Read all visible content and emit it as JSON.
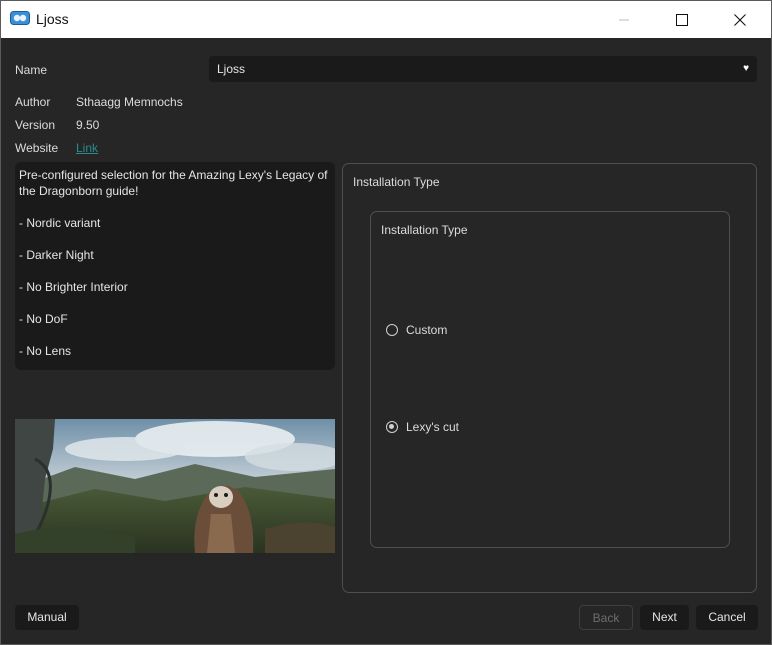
{
  "window": {
    "title": "Ljoss"
  },
  "header": {
    "name_label": "Name",
    "name_value": "Ljoss",
    "author_label": "Author",
    "author_value": "Sthaagg Memnochs",
    "version_label": "Version",
    "version_value": "9.50",
    "website_label": "Website",
    "website_link": "Link"
  },
  "description": {
    "lines": [
      "Pre-configured selection for the Amazing Lexy's Legacy of the Dragonborn guide!",
      "- Nordic variant",
      "- Darker Night",
      "- No Brighter Interior",
      "- No DoF",
      "- No Lens"
    ]
  },
  "installation": {
    "group_title": "Installation Type",
    "inner_title": "Installation Type",
    "options": [
      {
        "label": "Custom",
        "checked": false
      },
      {
        "label": "Lexy's cut",
        "checked": true
      }
    ]
  },
  "buttons": {
    "manual": "Manual",
    "back": "Back",
    "next": "Next",
    "cancel": "Cancel"
  },
  "colors": {
    "background": "#262626",
    "field": "#1a1a1a",
    "link": "#2a8c8c",
    "app_icon": "#3a8fd8"
  },
  "icons": {
    "app": "installer-logo-icon",
    "minimize": "minimize-icon",
    "maximize": "maximize-icon",
    "close": "close-icon",
    "dropdown": "heart-dropdown-icon"
  }
}
